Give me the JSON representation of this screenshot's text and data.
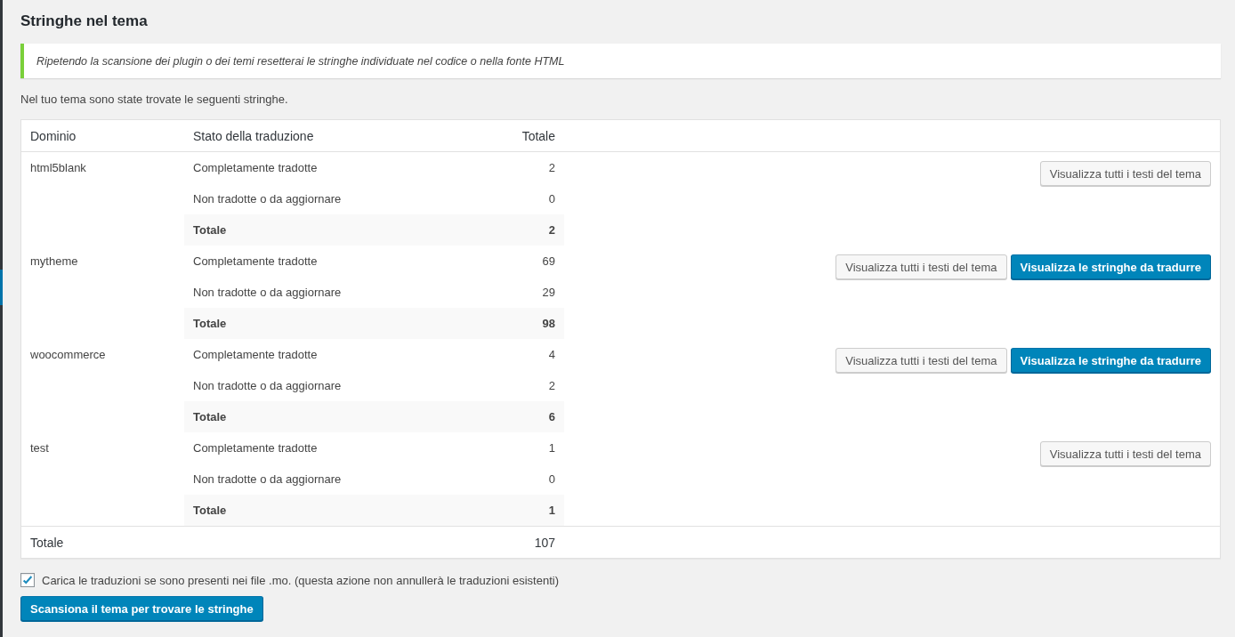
{
  "title": "Stringhe nel tema",
  "notice": "Ripetendo la scansione dei plugin o dei temi resetterai le stringhe individuate nel codice o nella fonte HTML",
  "intro": "Nel tuo tema sono state trovate le seguenti stringhe.",
  "table": {
    "columns": [
      "Dominio",
      "Stato della traduzione",
      "Totale"
    ],
    "groups": [
      {
        "domain": "html5blank",
        "rows": [
          {
            "kind": "normal",
            "label": "Completamente tradotte",
            "value": "2"
          },
          {
            "kind": "normal",
            "label": "Non tradotte o da aggiornare",
            "value": "0"
          },
          {
            "kind": "total",
            "label": "Totale",
            "value": "2"
          }
        ],
        "buttons": [
          {
            "kind": "secondary",
            "label": "Visualizza tutti i testi del tema"
          }
        ]
      },
      {
        "domain": "mytheme",
        "rows": [
          {
            "kind": "normal",
            "label": "Completamente tradotte",
            "value": "69"
          },
          {
            "kind": "normal",
            "label": "Non tradotte o da aggiornare",
            "value": "29"
          },
          {
            "kind": "total",
            "label": "Totale",
            "value": "98"
          }
        ],
        "buttons": [
          {
            "kind": "secondary",
            "label": "Visualizza tutti i testi del tema"
          },
          {
            "kind": "primary",
            "label": "Visualizza le stringhe da tradurre"
          }
        ]
      },
      {
        "domain": "woocommerce",
        "rows": [
          {
            "kind": "normal",
            "label": "Completamente tradotte",
            "value": "4"
          },
          {
            "kind": "normal",
            "label": "Non tradotte o da aggiornare",
            "value": "2"
          },
          {
            "kind": "total",
            "label": "Totale",
            "value": "6"
          }
        ],
        "buttons": [
          {
            "kind": "secondary",
            "label": "Visualizza tutti i testi del tema"
          },
          {
            "kind": "primary",
            "label": "Visualizza le stringhe da tradurre"
          }
        ]
      },
      {
        "domain": "test",
        "rows": [
          {
            "kind": "normal",
            "label": "Completamente tradotte",
            "value": "1"
          },
          {
            "kind": "normal",
            "label": "Non tradotte o da aggiornare",
            "value": "0"
          },
          {
            "kind": "total",
            "label": "Totale",
            "value": "1"
          }
        ],
        "buttons": [
          {
            "kind": "secondary",
            "label": "Visualizza tutti i testi del tema"
          }
        ]
      }
    ],
    "footer": {
      "label": "Totale",
      "value": "107"
    }
  },
  "load_mo": {
    "label": "Carica le traduzioni se sono presenti nei file .mo. (questa azione non annullerà le traduzioni esistenti)",
    "checked": true
  },
  "scan_button": "Scansiona il tema per trovare le stringhe"
}
